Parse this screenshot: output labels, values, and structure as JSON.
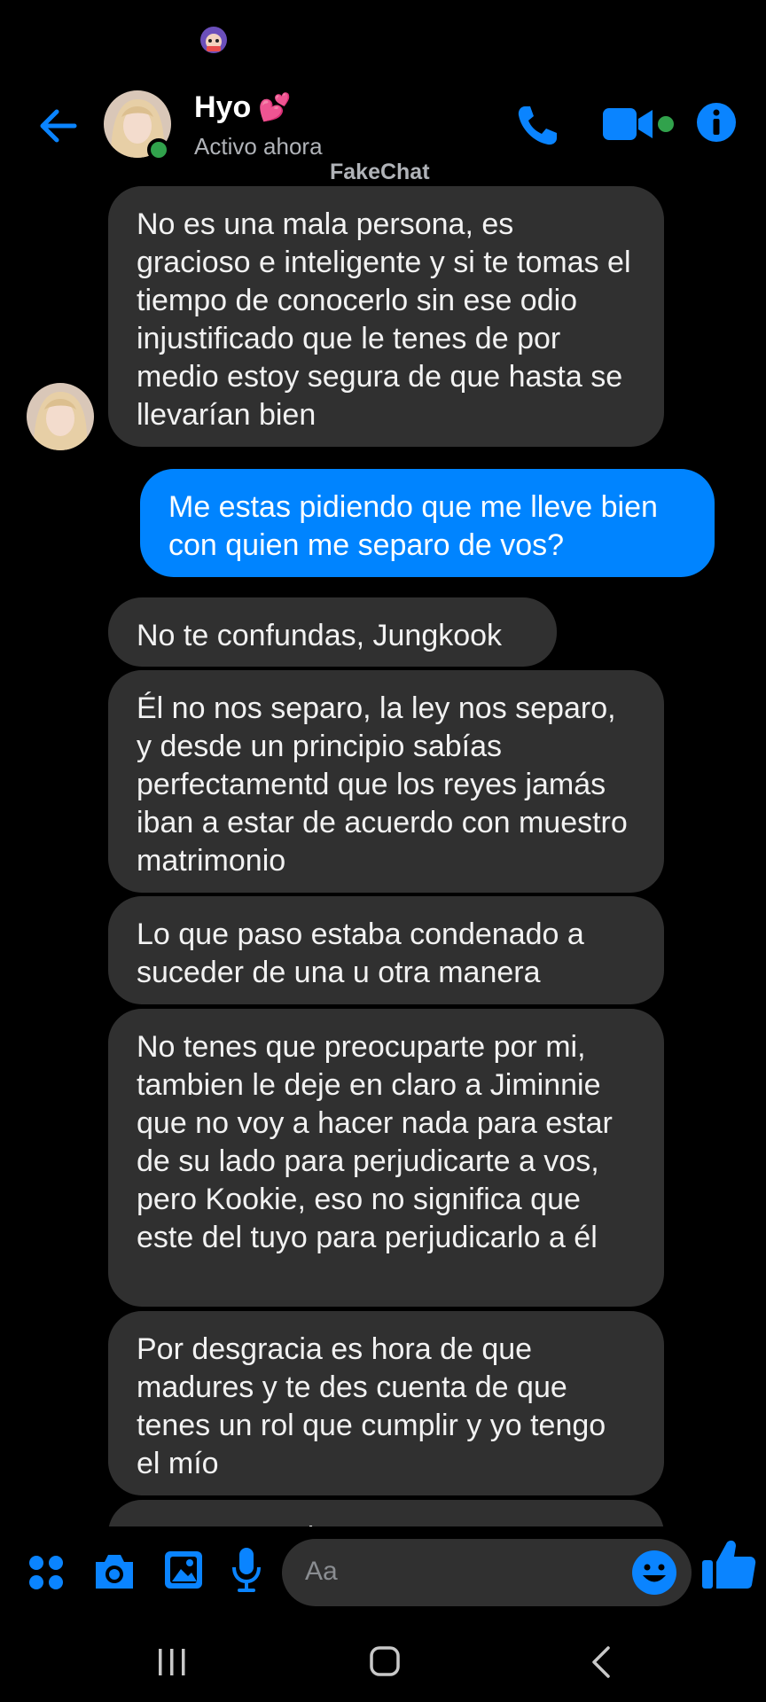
{
  "header": {
    "name": "Hyo",
    "name_emoji": "💕",
    "status": "Activo ahora",
    "watermark": "FakeChat",
    "icons": [
      "back-arrow-icon",
      "phone-icon",
      "video-camera-icon",
      "info-icon"
    ]
  },
  "messages": [
    {
      "side": "in",
      "text": "No es una mala persona, es gracioso e inteligente y si te tomas el tiempo de conocerlo sin ese odio injustificado que le tenes de por medio estoy segura de que hasta se llevarían bien"
    },
    {
      "side": "out",
      "text": "Me estas pidiendo que me lleve bien con quien me separo de vos?"
    },
    {
      "side": "in",
      "text": "No te confundas, Jungkook"
    },
    {
      "side": "in",
      "text": "Él no nos separo, la ley nos separo, y desde un principio sabías perfectamentd que los reyes jamás iban a estar de acuerdo con muestro matrimonio"
    },
    {
      "side": "in",
      "text": "Lo que paso estaba condenado a suceder de una u otra manera"
    },
    {
      "side": "in",
      "text": "No tenes que preocuparte por mi, tambien le deje en claro a Jiminnie que no voy a hacer nada para estar de su lado para perjudicarte a vos, pero Kookie, eso no significa que este del tuyo para perjudicarlo a él"
    },
    {
      "side": "in",
      "text": "Por desgracia es hora de que madures y te des cuenta de que tenes un rol que cumplir y yo tengo el mío"
    },
    {
      "side": "in",
      "text": "No te tomes la ...",
      "partial": true
    }
  ],
  "composer": {
    "placeholder": "Aa",
    "icons": [
      "apps-grid-icon",
      "camera-icon",
      "gallery-icon",
      "microphone-icon",
      "emoji-icon",
      "thumbs-up-icon"
    ]
  },
  "navbar": {
    "icons": [
      "recent-apps-icon",
      "home-icon",
      "back-icon"
    ]
  },
  "colors": {
    "accent": "#0084ff",
    "incoming_bubble": "#303030",
    "online": "#31a24c",
    "background": "#000000"
  }
}
